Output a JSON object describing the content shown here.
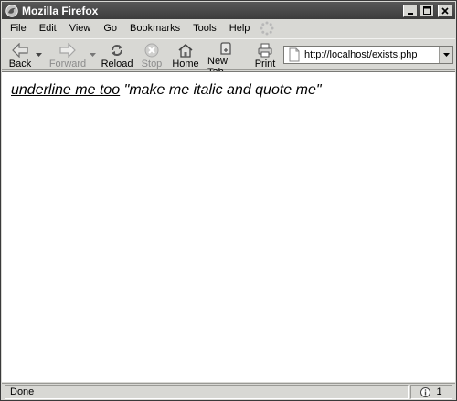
{
  "window": {
    "title": "Mozilla Firefox"
  },
  "menu": {
    "items": [
      "File",
      "Edit",
      "View",
      "Go",
      "Bookmarks",
      "Tools",
      "Help"
    ]
  },
  "toolbar": {
    "back_label": "Back",
    "forward_label": "Forward",
    "reload_label": "Reload",
    "stop_label": "Stop",
    "home_label": "Home",
    "newtab_label": "New Tab",
    "print_label": "Print"
  },
  "urlbar": {
    "url": "http://localhost/exists.php"
  },
  "page": {
    "underlined_text": "underline me too",
    "quoted_text": "\"make me italic and quote me\""
  },
  "status": {
    "text": "Done",
    "info_count": "1"
  },
  "colors": {
    "titlebar": "#4a4a4a",
    "chrome": "#d8d8d4",
    "content": "#ffffff"
  }
}
